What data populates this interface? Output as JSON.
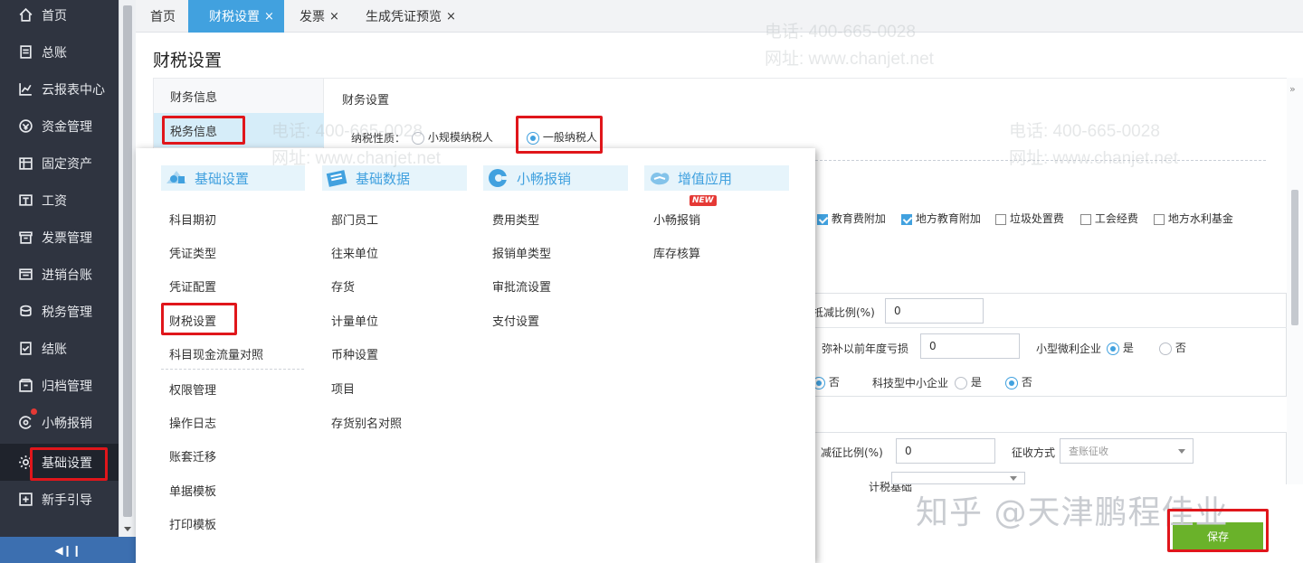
{
  "sidebar": {
    "items": [
      {
        "label": "首页",
        "icon": "home-icon"
      },
      {
        "label": "总账",
        "icon": "ledger-icon"
      },
      {
        "label": "云报表中心",
        "icon": "chart-icon"
      },
      {
        "label": "资金管理",
        "icon": "money-icon"
      },
      {
        "label": "固定资产",
        "icon": "asset-icon"
      },
      {
        "label": "工资",
        "icon": "salary-icon"
      },
      {
        "label": "发票管理",
        "icon": "invoice-icon"
      },
      {
        "label": "进销台账",
        "icon": "inventory-icon"
      },
      {
        "label": "税务管理",
        "icon": "tax-icon"
      },
      {
        "label": "结账",
        "icon": "close-account-icon"
      },
      {
        "label": "归档管理",
        "icon": "archive-icon"
      },
      {
        "label": "小畅报销",
        "icon": "reimburse-icon"
      },
      {
        "label": "基础设置",
        "icon": "gear-icon"
      },
      {
        "label": "新手引导",
        "icon": "guide-icon"
      }
    ]
  },
  "tabs": [
    {
      "label": "首页",
      "closable": false
    },
    {
      "label": "财税设置",
      "closable": true,
      "active": true
    },
    {
      "label": "发票",
      "closable": true
    },
    {
      "label": "生成凭证预览",
      "closable": true
    }
  ],
  "close_glyph": "×",
  "page": {
    "title": "财税设置",
    "leftnav": [
      "财务信息",
      "税务信息"
    ],
    "section": "财务设置",
    "taxpayer_label": "纳税性质：",
    "taxpayer_small": "小规模纳税人",
    "taxpayer_general": "一般纳税人",
    "checks": [
      {
        "label": "教育费附加",
        "checked": true
      },
      {
        "label": "地方教育附加",
        "checked": true
      },
      {
        "label": "垃圾处置费",
        "checked": false
      },
      {
        "label": "工会经费",
        "checked": false
      },
      {
        "label": "地方水利基金",
        "checked": false
      }
    ],
    "reduce_ratio_label": "抵减比例(%)",
    "reduce_ratio_value": "0",
    "loss_label": "弥补以前年度亏损",
    "loss_value": "0",
    "micro_label": "小型微利企业",
    "yes": "是",
    "no": "否",
    "tech_label": "科技型中小企业",
    "levy_ratio_label": "减征比例(%)",
    "levy_ratio_value": "0",
    "levy_mode_label": "征收方式",
    "levy_mode_value": "查账征收",
    "basis_label": "计税基础"
  },
  "menu": {
    "columns": [
      {
        "title": "基础设置",
        "icon": "basic-settings-icon",
        "items": [
          "科目期初",
          "凭证类型",
          "凭证配置",
          "财税设置",
          "科目现金流量对照",
          "权限管理",
          "操作日志",
          "账套迁移",
          "单据模板",
          "打印模板"
        ]
      },
      {
        "title": "基础数据",
        "icon": "basic-data-icon",
        "items": [
          "部门员工",
          "往来单位",
          "存货",
          "计量单位",
          "币种设置",
          "项目",
          "存货别名对照"
        ]
      },
      {
        "title": "小畅报销",
        "icon": "reimburse-app-icon",
        "items": [
          "费用类型",
          "报销单类型",
          "审批流设置",
          "支付设置"
        ]
      },
      {
        "title": "增值应用",
        "icon": "value-added-icon",
        "items": [
          "小畅报销",
          "库存核算"
        ]
      }
    ],
    "new_badge": "NEW"
  },
  "save_label": "保存",
  "watermark": "知乎 @天津鹏程佳业",
  "bg_watermark": {
    "phone": "电话: 400-665-0028",
    "site": "网址: www.chanjet.net"
  },
  "colors": {
    "accent": "#41a1df",
    "sidebar": "#2f3440",
    "save": "#6ab22a",
    "highlight": "#e0161b"
  }
}
